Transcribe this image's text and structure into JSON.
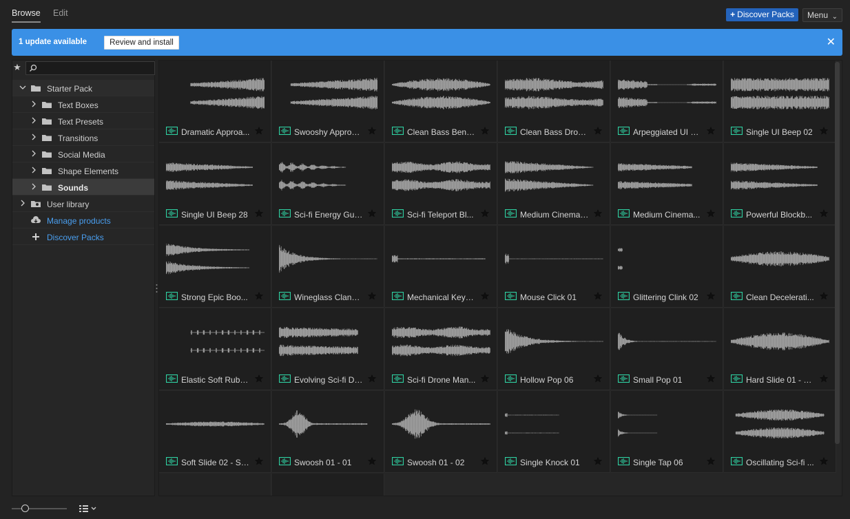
{
  "tabs": [
    {
      "label": "Browse",
      "active": true
    },
    {
      "label": "Edit",
      "active": false
    }
  ],
  "header": {
    "discover_label": "Discover Packs",
    "menu_label": "Menu"
  },
  "banner": {
    "text": "1 update available",
    "review_label": "Review and install"
  },
  "search": {
    "placeholder": ""
  },
  "tree": {
    "starter_pack": "Starter Pack",
    "children": [
      "Text Boxes",
      "Text Presets",
      "Transitions",
      "Social Media",
      "Shape Elements",
      "Sounds"
    ],
    "selected": "Sounds",
    "user_library": "User library",
    "manage_products": "Manage products",
    "discover_packs": "Discover Packs"
  },
  "colors": {
    "accent": "#2463bb",
    "banner": "#3a90e6",
    "link": "#4a9ff0",
    "audio_icon": "#2fd1a2"
  },
  "items": [
    {
      "title": "Dramatic Approa...",
      "wave": "swell"
    },
    {
      "title": "Swooshy Approa...",
      "wave": "rise"
    },
    {
      "title": "Clean Bass Bend ...",
      "wave": "bend"
    },
    {
      "title": "Clean Bass Drop ...",
      "wave": "drop"
    },
    {
      "title": "Arpeggiated UI B...",
      "wave": "arp"
    },
    {
      "title": "Single UI Beep 02",
      "wave": "block"
    },
    {
      "title": "Single UI Beep 28",
      "wave": "fade"
    },
    {
      "title": "Sci-fi Energy Gun...",
      "wave": "burst"
    },
    {
      "title": "Sci-fi Teleport Bl...",
      "wave": "dense"
    },
    {
      "title": "Medium Cinemat...",
      "wave": "wobble"
    },
    {
      "title": "Medium Cinema...",
      "wave": "medium"
    },
    {
      "title": "Powerful Blockb...",
      "wave": "fade"
    },
    {
      "title": "Strong Epic Boo...",
      "wave": "boom"
    },
    {
      "title": "Wineglass Clang ...",
      "wave": "clang"
    },
    {
      "title": "Mechanical Keyb...",
      "wave": "thin"
    },
    {
      "title": "Mouse Click 01",
      "wave": "click"
    },
    {
      "title": "Glittering Clink 02",
      "wave": "tiny"
    },
    {
      "title": "Clean Decelerati...",
      "wave": "decel"
    },
    {
      "title": "Elastic Soft Rubb...",
      "wave": "dots"
    },
    {
      "title": "Evolving Sci-fi Dr...",
      "wave": "stack"
    },
    {
      "title": "Sci-fi Drone Man...",
      "wave": "dense"
    },
    {
      "title": "Hollow Pop 06",
      "wave": "pop"
    },
    {
      "title": "Small Pop 01",
      "wave": "smallpop"
    },
    {
      "title": "Hard Slide 01 - S...",
      "wave": "slide"
    },
    {
      "title": "Soft Slide 02 - Sh...",
      "wave": "soft"
    },
    {
      "title": "Swoosh 01 - 01",
      "wave": "swoosh"
    },
    {
      "title": "Swoosh 01 - 02",
      "wave": "swoosh2"
    },
    {
      "title": "Single Knock 01",
      "wave": "knock"
    },
    {
      "title": "Single Tap 06",
      "wave": "tap"
    },
    {
      "title": "Oscillating Sci-fi ...",
      "wave": "osc"
    }
  ]
}
